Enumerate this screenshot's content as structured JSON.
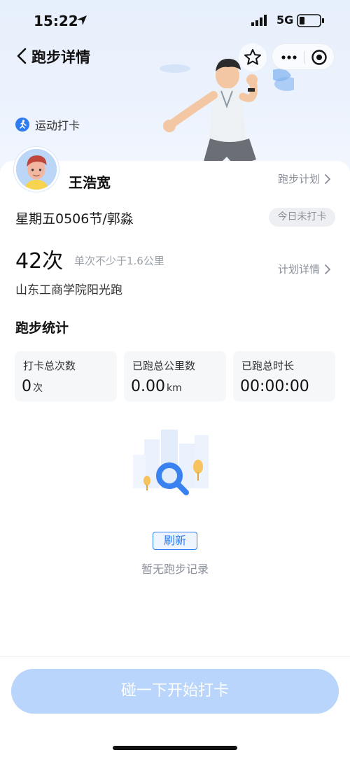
{
  "status_bar": {
    "time": "15:22",
    "network": "5G"
  },
  "nav": {
    "title": "跑步详情"
  },
  "banner": {
    "tag_label": "运动打卡"
  },
  "profile": {
    "name": "王浩宽",
    "plan_link": "跑步计划"
  },
  "course": {
    "text": "星期五0506节/郭淼",
    "status_badge": "今日未打卡"
  },
  "requirement": {
    "count": "42次",
    "note": "单次不少于1.6公里",
    "detail_link": "计划详情",
    "location": "山东工商学院阳光跑"
  },
  "stats": {
    "title": "跑步统计",
    "items": [
      {
        "label": "打卡总次数",
        "value": "0",
        "unit": "次"
      },
      {
        "label": "已跑总公里数",
        "value": "0.00",
        "unit": "km"
      },
      {
        "label": "已跑总时长",
        "value": "00:00:00",
        "unit": ""
      }
    ]
  },
  "empty": {
    "refresh_label": "刷新",
    "text": "暂无跑步记录"
  },
  "action": {
    "checkin_label": "碰一下开始打卡"
  },
  "colors": {
    "accent": "#2d7cf0",
    "button_disabled": "#b9d5fb",
    "hero_bg": "#e6effc"
  }
}
